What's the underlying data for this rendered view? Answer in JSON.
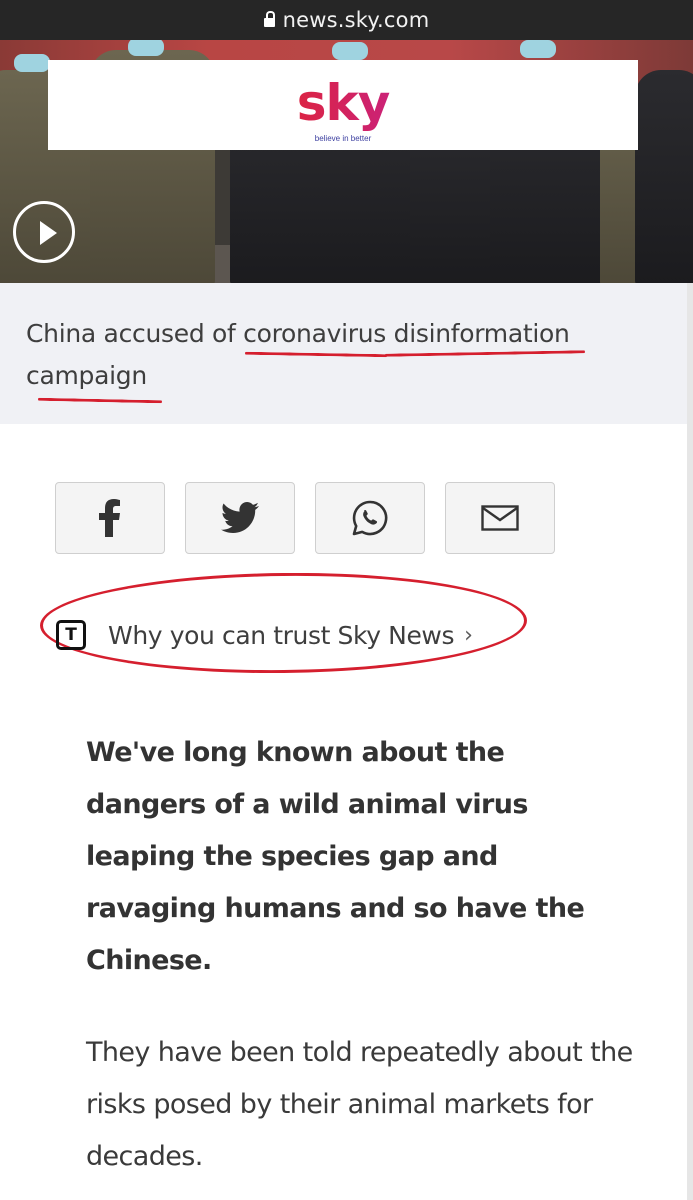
{
  "browser": {
    "url": "news.sky.com"
  },
  "hero": {
    "logo_text": "sky",
    "logo_tagline": "believe in better",
    "play_icon": "play-icon"
  },
  "caption": {
    "line1": "China accused of coronavirus disinformation",
    "line2": "campaign"
  },
  "share": {
    "buttons": [
      {
        "icon": "facebook-icon"
      },
      {
        "icon": "twitter-icon"
      },
      {
        "icon": "whatsapp-icon"
      },
      {
        "icon": "email-icon"
      }
    ]
  },
  "trust": {
    "icon_letter": "T",
    "label": "Why you can trust Sky News",
    "chevron": "›"
  },
  "article": {
    "lede": "We've long known about the dangers of a wild animal virus leaping the species gap and ravaging humans and so have the Chinese.",
    "paragraph": "They have been told repeatedly about the risks posed by their animal markets for decades."
  },
  "colors": {
    "annotation_red": "#d51f2e",
    "caption_bg": "#f0f1f5",
    "url_bar": "#262626"
  }
}
